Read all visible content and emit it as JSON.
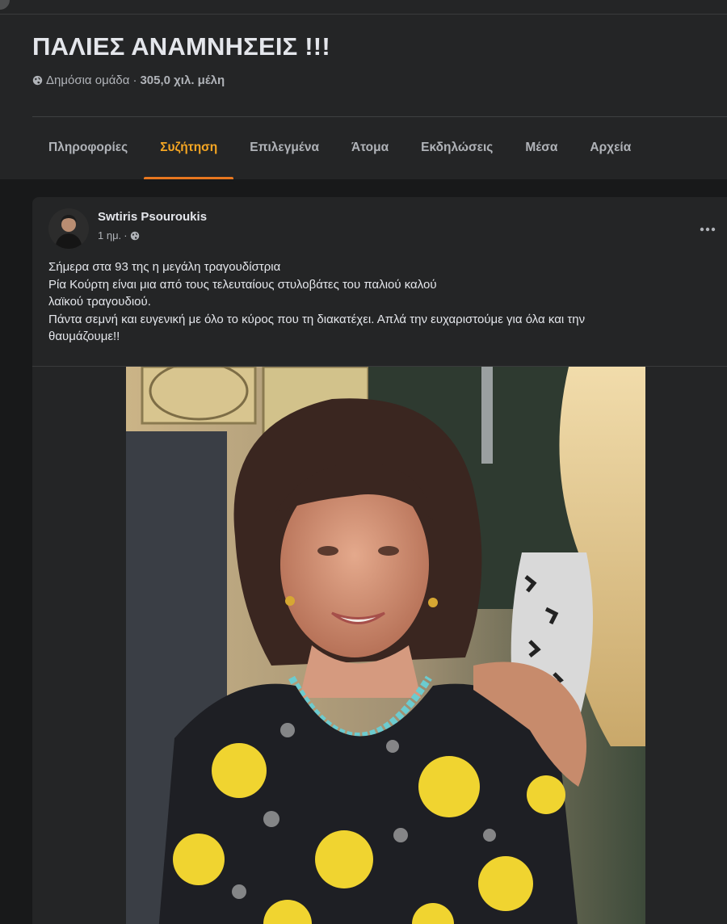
{
  "group": {
    "title": "ΠΑΛΙΕΣ ΑΝΑΜΝΗΣΕΙΣ !!!",
    "privacy": "Δημόσια ομάδα",
    "separator": "·",
    "members": "305,0 χιλ. μέλη"
  },
  "tabs": [
    {
      "label": "Πληροφορίες"
    },
    {
      "label": "Συζήτηση",
      "active": true
    },
    {
      "label": "Επιλεγμένα"
    },
    {
      "label": "Άτομα"
    },
    {
      "label": "Εκδηλώσεις"
    },
    {
      "label": "Μέσα"
    },
    {
      "label": "Αρχεία"
    }
  ],
  "post": {
    "author": "Swtiris Psouroukis",
    "time": "1 ημ.",
    "separator": "·",
    "lines": [
      "Σήμερα στα 93 της η μεγάλη τραγουδίστρια",
      "Ρία Κούρτη είναι μια από τους τελευταίους στυλοβάτες του παλιού καλού",
      "λαϊκού τραγουδιού.",
      "Πάντα σεμνή και ευγενική με όλο το κύρος που τη διακατέχει. Απλά την ευχαριστούμε για όλα και την",
      "θαυμάζουμε!!"
    ]
  },
  "colors": {
    "accent": "#f5a623",
    "tab_underline": "#e8771f",
    "background": "#18191a",
    "surface": "#242526"
  }
}
